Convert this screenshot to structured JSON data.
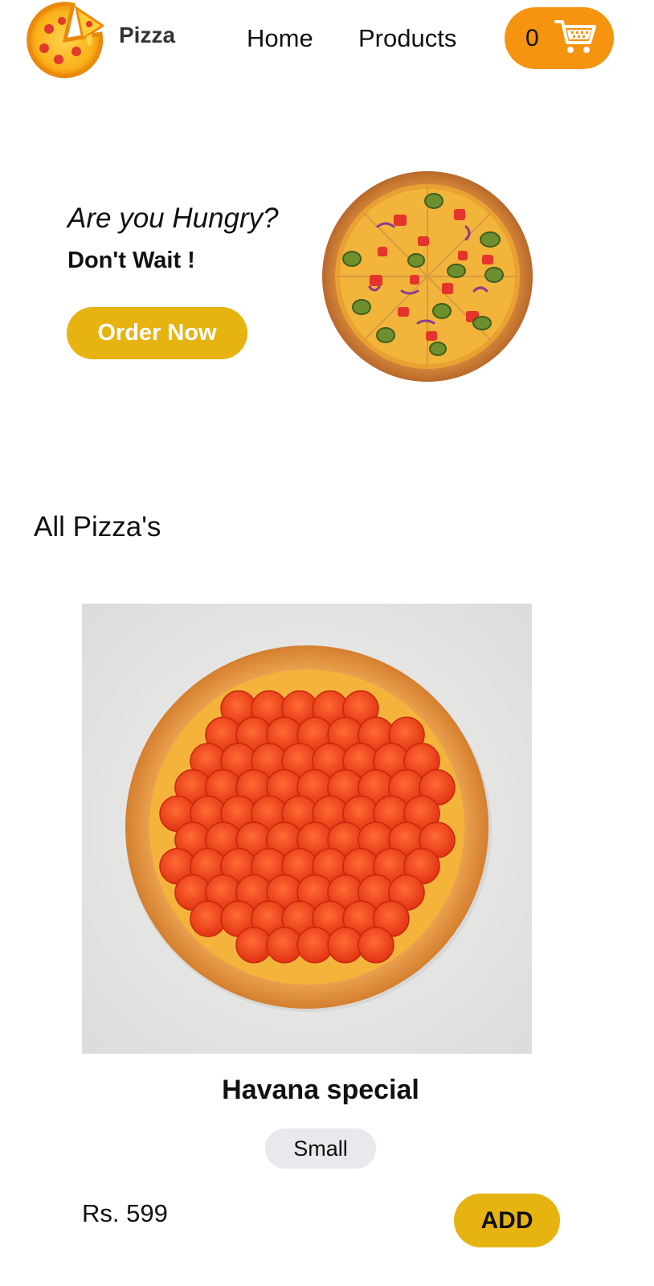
{
  "navbar": {
    "logo_icon": "pizza-slice-logo",
    "brand": "Pizza",
    "links": [
      "Home",
      "Products"
    ],
    "cart": {
      "count": "0",
      "icon": "shopping-cart-icon"
    }
  },
  "hero": {
    "question": "Are you Hungry?",
    "tagline": "Don't Wait !",
    "cta_label": "Order Now",
    "image_icon": "veggie-pizza-image"
  },
  "products_section": {
    "title": "All Pizza's",
    "items": [
      {
        "image_icon": "pepperoni-pizza-image",
        "name": "Havana special",
        "size": "Small",
        "price": "Rs. 599",
        "add_label": "ADD"
      }
    ]
  },
  "colors": {
    "accent_orange": "#f6930f",
    "accent_yellow": "#e6b311",
    "badge_gray": "#e8e9ec"
  }
}
